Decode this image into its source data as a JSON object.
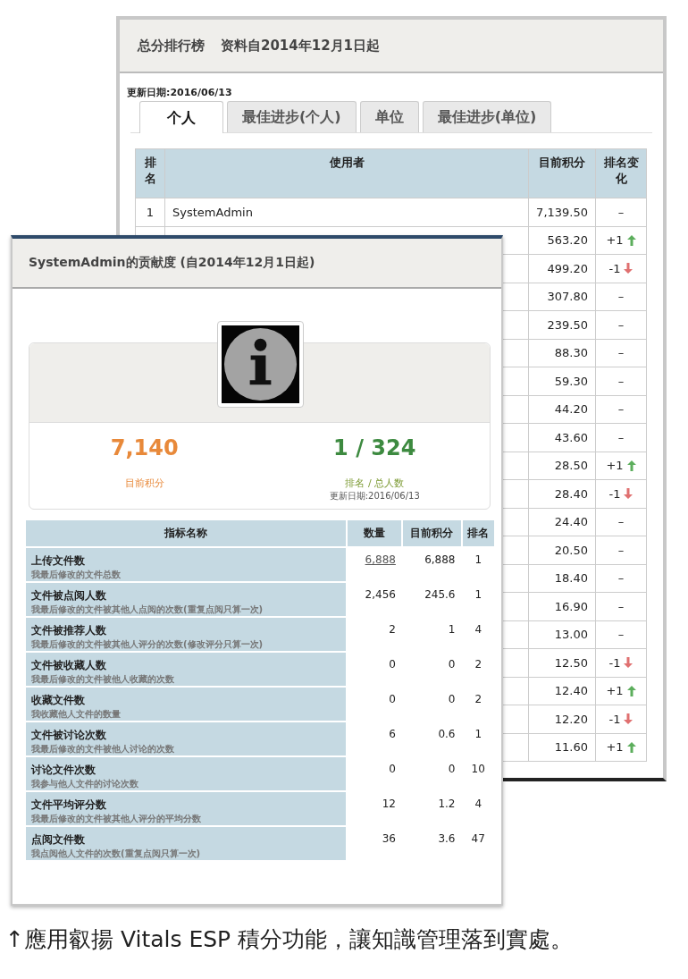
{
  "leaderboard": {
    "title": "总分排行榜",
    "subtitle": "资料自2014年12月1日起",
    "updated": "更新日期:2016/06/13",
    "tabs": [
      {
        "label": "个人",
        "selected": true
      },
      {
        "label": "最佳进步(个人)",
        "selected": false
      },
      {
        "label": "单位",
        "selected": false
      },
      {
        "label": "最佳进步(单位)",
        "selected": false
      }
    ],
    "columns": [
      "排名",
      "使用者",
      "目前积分",
      "排名变化"
    ],
    "rows": [
      {
        "rank": "1",
        "user": "SystemAdmin",
        "score": "7,139.50",
        "change": "–",
        "kind": "flat"
      },
      {
        "score": "563.20",
        "change": "+1",
        "kind": "up"
      },
      {
        "score": "499.20",
        "change": "-1",
        "kind": "down"
      },
      {
        "score": "307.80",
        "change": "–",
        "kind": "flat"
      },
      {
        "score": "239.50",
        "change": "–",
        "kind": "flat"
      },
      {
        "score": "88.30",
        "change": "–",
        "kind": "flat"
      },
      {
        "score": "59.30",
        "change": "–",
        "kind": "flat"
      },
      {
        "score": "44.20",
        "change": "–",
        "kind": "flat"
      },
      {
        "score": "43.60",
        "change": "–",
        "kind": "flat"
      },
      {
        "score": "28.50",
        "change": "+1",
        "kind": "up"
      },
      {
        "score": "28.40",
        "change": "-1",
        "kind": "down"
      },
      {
        "score": "24.40",
        "change": "–",
        "kind": "flat"
      },
      {
        "score": "20.50",
        "change": "–",
        "kind": "flat"
      },
      {
        "score": "18.40",
        "change": "–",
        "kind": "flat"
      },
      {
        "score": "16.90",
        "change": "–",
        "kind": "flat"
      },
      {
        "score": "13.00",
        "change": "–",
        "kind": "flat"
      },
      {
        "score": "12.50",
        "change": "-1",
        "kind": "down"
      },
      {
        "score": "12.40",
        "change": "+1",
        "kind": "up"
      },
      {
        "score": "12.20",
        "change": "-1",
        "kind": "down"
      },
      {
        "score": "11.60",
        "change": "+1",
        "kind": "up"
      }
    ]
  },
  "contribution": {
    "title": "SystemAdmin的贡献度 (自2014年12月1日起)",
    "points": "7,140",
    "points_label": "目前积分",
    "rank": "1 / 324",
    "rank_label": "排名 / 总人数",
    "updated": "更新日期:2016/06/13",
    "columns": [
      "指标名称",
      "数量",
      "目前积分",
      "排名"
    ],
    "rows": [
      {
        "name": "上传文件数",
        "description": "我最后修改的文件总数",
        "count": "6,888",
        "linked": true,
        "score": "6,888",
        "rank": "1"
      },
      {
        "name": "文件被点阅人数",
        "description": "我最后修改的文件被其他人点阅的次数(重复点阅只算一次)",
        "count": "2,456",
        "linked": false,
        "score": "245.6",
        "rank": "1"
      },
      {
        "name": "文件被推荐人数",
        "description": "我最后修改的文件被其他人评分的次数(修改评分只算一次)",
        "count": "2",
        "linked": false,
        "score": "1",
        "rank": "4"
      },
      {
        "name": "文件被收藏人数",
        "description": "我最后修改的文件被他人收藏的次数",
        "count": "0",
        "linked": false,
        "score": "0",
        "rank": "2"
      },
      {
        "name": "收藏文件数",
        "description": "我收藏他人文件的数量",
        "count": "0",
        "linked": false,
        "score": "0",
        "rank": "2"
      },
      {
        "name": "文件被讨论次数",
        "description": "我最后修改的文件被他人讨论的次数",
        "count": "6",
        "linked": false,
        "score": "0.6",
        "rank": "1"
      },
      {
        "name": "讨论文件次数",
        "description": "我参与他人文件的讨论次数",
        "count": "0",
        "linked": false,
        "score": "0",
        "rank": "10"
      },
      {
        "name": "文件平均评分数",
        "description": "我最后修改的文件被其他人评分的平均分数",
        "count": "12",
        "linked": false,
        "score": "1.2",
        "rank": "4"
      },
      {
        "name": "点阅文件数",
        "description": "我点阅他人文件的次数(重复点阅只算一次)",
        "count": "36",
        "linked": false,
        "score": "3.6",
        "rank": "47"
      }
    ]
  },
  "caption": "↑應用叡揚 Vitals ESP 積分功能，讓知識管理落到實處。"
}
